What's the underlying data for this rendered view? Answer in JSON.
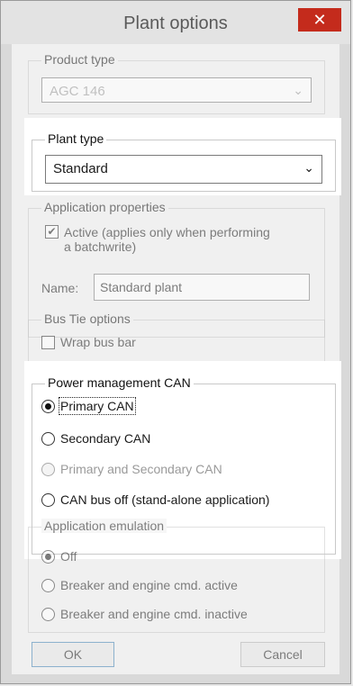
{
  "window": {
    "title": "Plant options",
    "close_glyph": "✕"
  },
  "product_type": {
    "legend": "Product type",
    "value": "AGC 146"
  },
  "plant_type": {
    "legend": "Plant type",
    "value": "Standard"
  },
  "application_properties": {
    "legend": "Application properties",
    "active_label_line1": "Active (applies only when performing",
    "active_label_line2": "a batchwrite)",
    "active_checked": true,
    "name_label": "Name:",
    "name_value": "Standard plant"
  },
  "bus_tie": {
    "legend": "Bus Tie options",
    "wrap_label": "Wrap bus bar",
    "wrap_checked": false
  },
  "power_management": {
    "legend": "Power management CAN",
    "options": [
      {
        "label": "Primary CAN",
        "selected": true,
        "enabled": true
      },
      {
        "label": "Secondary CAN",
        "selected": false,
        "enabled": true
      },
      {
        "label": "Primary and Secondary CAN",
        "selected": false,
        "enabled": false
      },
      {
        "label": "CAN bus off (stand-alone application)",
        "selected": false,
        "enabled": true
      }
    ]
  },
  "application_emulation": {
    "legend": "Application emulation",
    "options": [
      {
        "label": "Off",
        "selected": true
      },
      {
        "label": "Breaker and engine cmd. active",
        "selected": false
      },
      {
        "label": "Breaker and engine cmd. inactive",
        "selected": false
      }
    ]
  },
  "buttons": {
    "ok": "OK",
    "cancel": "Cancel"
  },
  "icons": {
    "dropdown": "chevron-down-icon",
    "close": "close-icon"
  }
}
